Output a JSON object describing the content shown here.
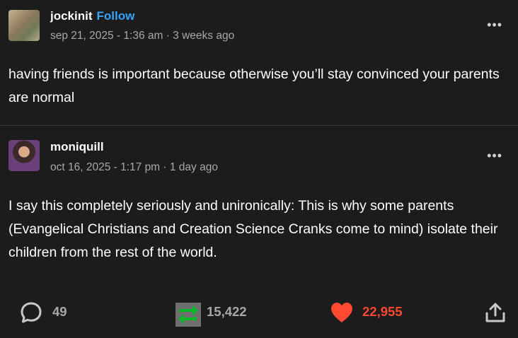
{
  "post1": {
    "username": "jockinit",
    "follow_label": "Follow",
    "meta": "sep 21, 2025 - 1:36 am · 3 weeks ago",
    "text": "having friends is important because otherwise you’ll stay convinced your parents are normal"
  },
  "post2": {
    "username": "moniquill",
    "meta": "oct 16, 2025 - 1:17 pm · 1 day ago",
    "text": "I say this completely seriously and unironically: This is why some parents (Evangelical Christians and Creation Science Cranks come to mind) isolate their children from the rest of the world."
  },
  "more_label": "•••",
  "footer": {
    "replies": "49",
    "reblogs": "15,422",
    "likes": "22,955"
  },
  "colors": {
    "background": "#1c1c1c",
    "follow": "#35a3ff",
    "reblog": "#00b929",
    "like": "#ff4930",
    "muted": "#a8a8a8"
  },
  "icons": {
    "reply": "speech-bubble-icon",
    "reblog": "reblog-arrows-icon",
    "like": "heart-icon",
    "share": "share-upload-icon",
    "more": "ellipsis-icon"
  }
}
